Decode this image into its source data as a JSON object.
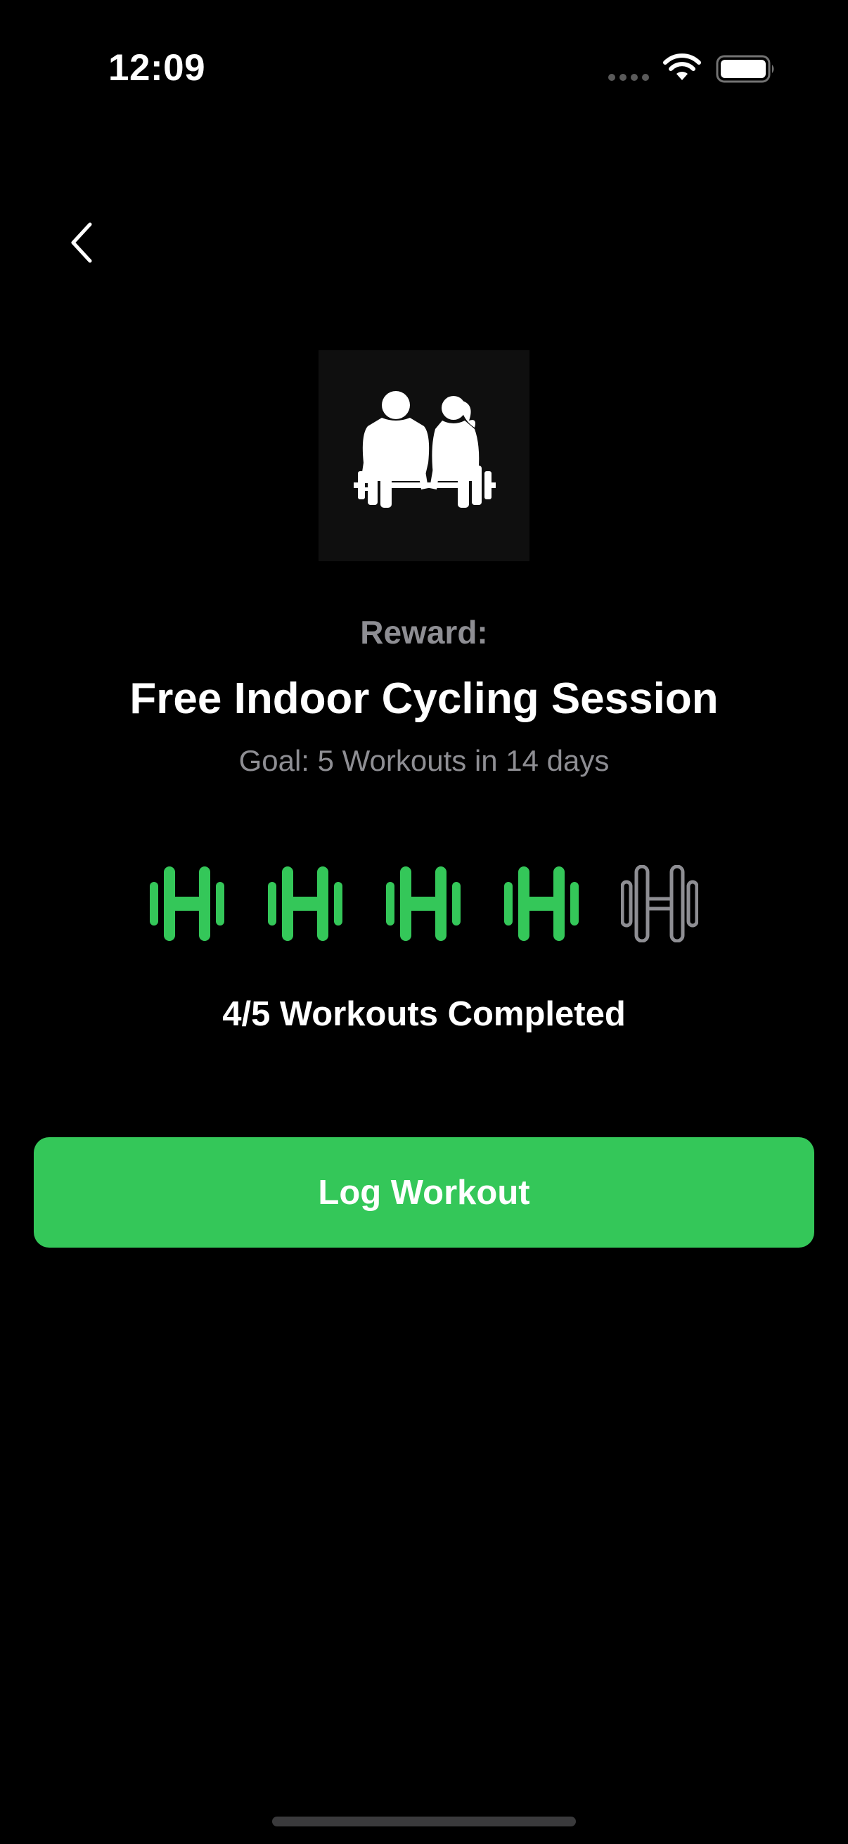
{
  "status_bar": {
    "time": "12:09",
    "signal_icon": "signal-dots-icon",
    "wifi_icon": "wifi-icon",
    "battery_icon": "battery-icon"
  },
  "nav": {
    "back_icon": "chevron-left-icon"
  },
  "reward": {
    "image_icon": "couple-weightlifting-icon",
    "label": "Reward:",
    "title": "Free Indoor Cycling Session",
    "goal": "Goal: 5 Workouts in 14 days"
  },
  "progress": {
    "completed": 4,
    "total": 5,
    "text": "4/5 Workouts Completed",
    "items": [
      {
        "state": "completed",
        "icon": "dumbbell-icon"
      },
      {
        "state": "completed",
        "icon": "dumbbell-icon"
      },
      {
        "state": "completed",
        "icon": "dumbbell-icon"
      },
      {
        "state": "completed",
        "icon": "dumbbell-icon"
      },
      {
        "state": "pending",
        "icon": "dumbbell-outline-icon"
      }
    ]
  },
  "actions": {
    "log_workout_label": "Log Workout"
  },
  "colors": {
    "background": "#000000",
    "accent_green": "#34c759",
    "secondary_text": "#8e8e93",
    "pending_icon": "#8e8e93"
  }
}
